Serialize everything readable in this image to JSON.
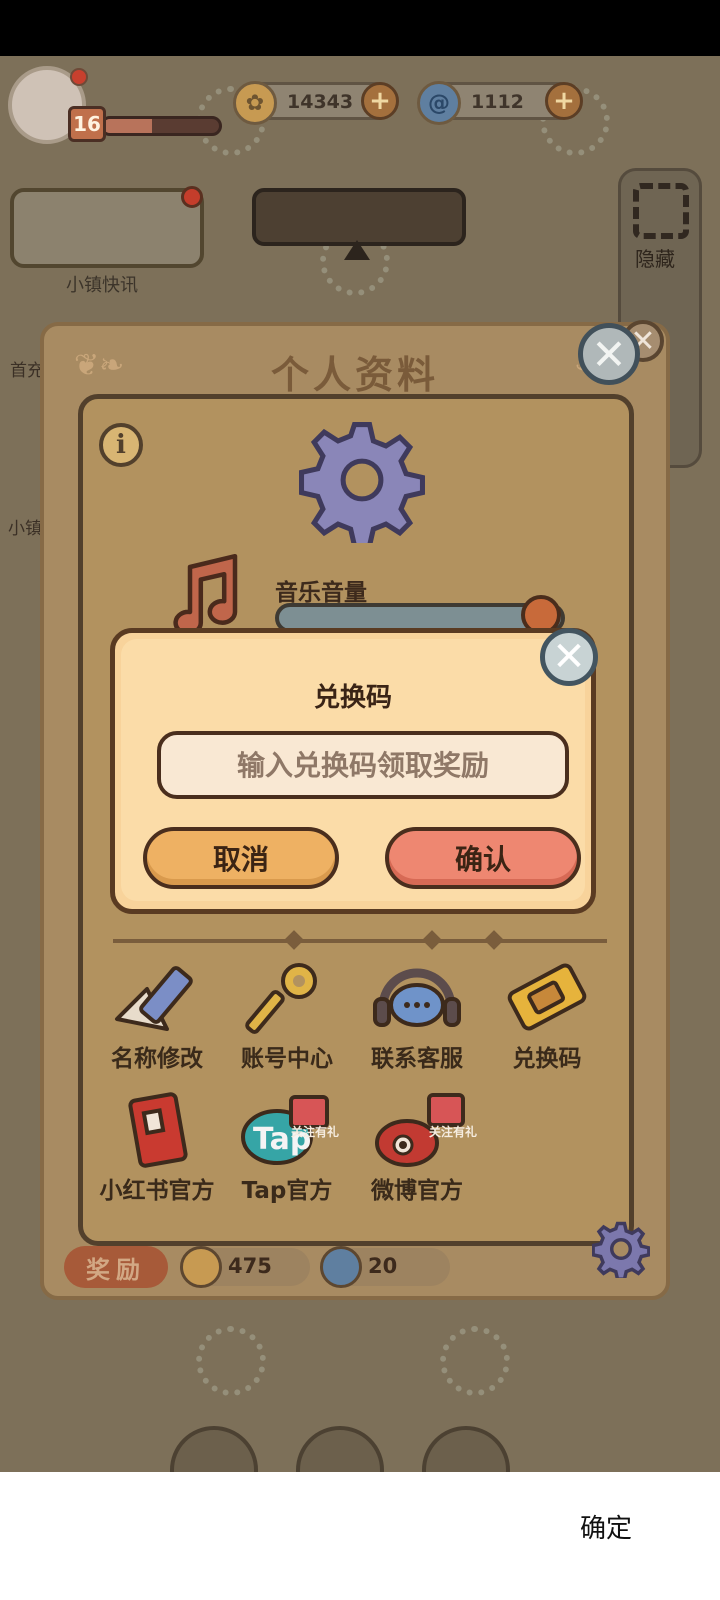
{
  "hud": {
    "level": "16",
    "xp_fraction": 0.42,
    "coins": "14343",
    "gems": "1112",
    "plus_label": "+"
  },
  "left_panel": {
    "news_label": "小镇快讯",
    "side_label_1": "首充",
    "side_label_2": "小镇"
  },
  "right_panel": {
    "hide_label": "隐藏"
  },
  "profile": {
    "title": "个人资料",
    "info_glyph": "i",
    "close_glyph": "✕",
    "music_label": "音乐音量",
    "music_volume": 0.95,
    "items": [
      {
        "label": "名称修改",
        "icon": "pencil-icon"
      },
      {
        "label": "账号中心",
        "icon": "key-icon"
      },
      {
        "label": "联系客服",
        "icon": "headset-icon"
      },
      {
        "label": "兑换码",
        "icon": "ticket-icon"
      },
      {
        "label": "小红书官方",
        "icon": "book-icon"
      },
      {
        "label": "Tap官方",
        "icon": "tap-icon",
        "gift_tag": "关注有礼"
      },
      {
        "label": "微博官方",
        "icon": "weibo-icon",
        "gift_tag": "关注有礼"
      }
    ],
    "reward_label": "奖励",
    "reward_coins": "475",
    "reward_gems": "20"
  },
  "dialog": {
    "title": "兑换码",
    "placeholder": "输入兑换码领取奖励",
    "value": "",
    "cancel_label": "取消",
    "confirm_label": "确认",
    "close_glyph": "✕"
  },
  "system_bar": {
    "ok_label": "确定"
  },
  "colors": {
    "dialog_bg": "#fbdca8",
    "cancel_btn": "#eeb163",
    "confirm_btn": "#ee8771",
    "panel_bg": "#b2925f"
  }
}
